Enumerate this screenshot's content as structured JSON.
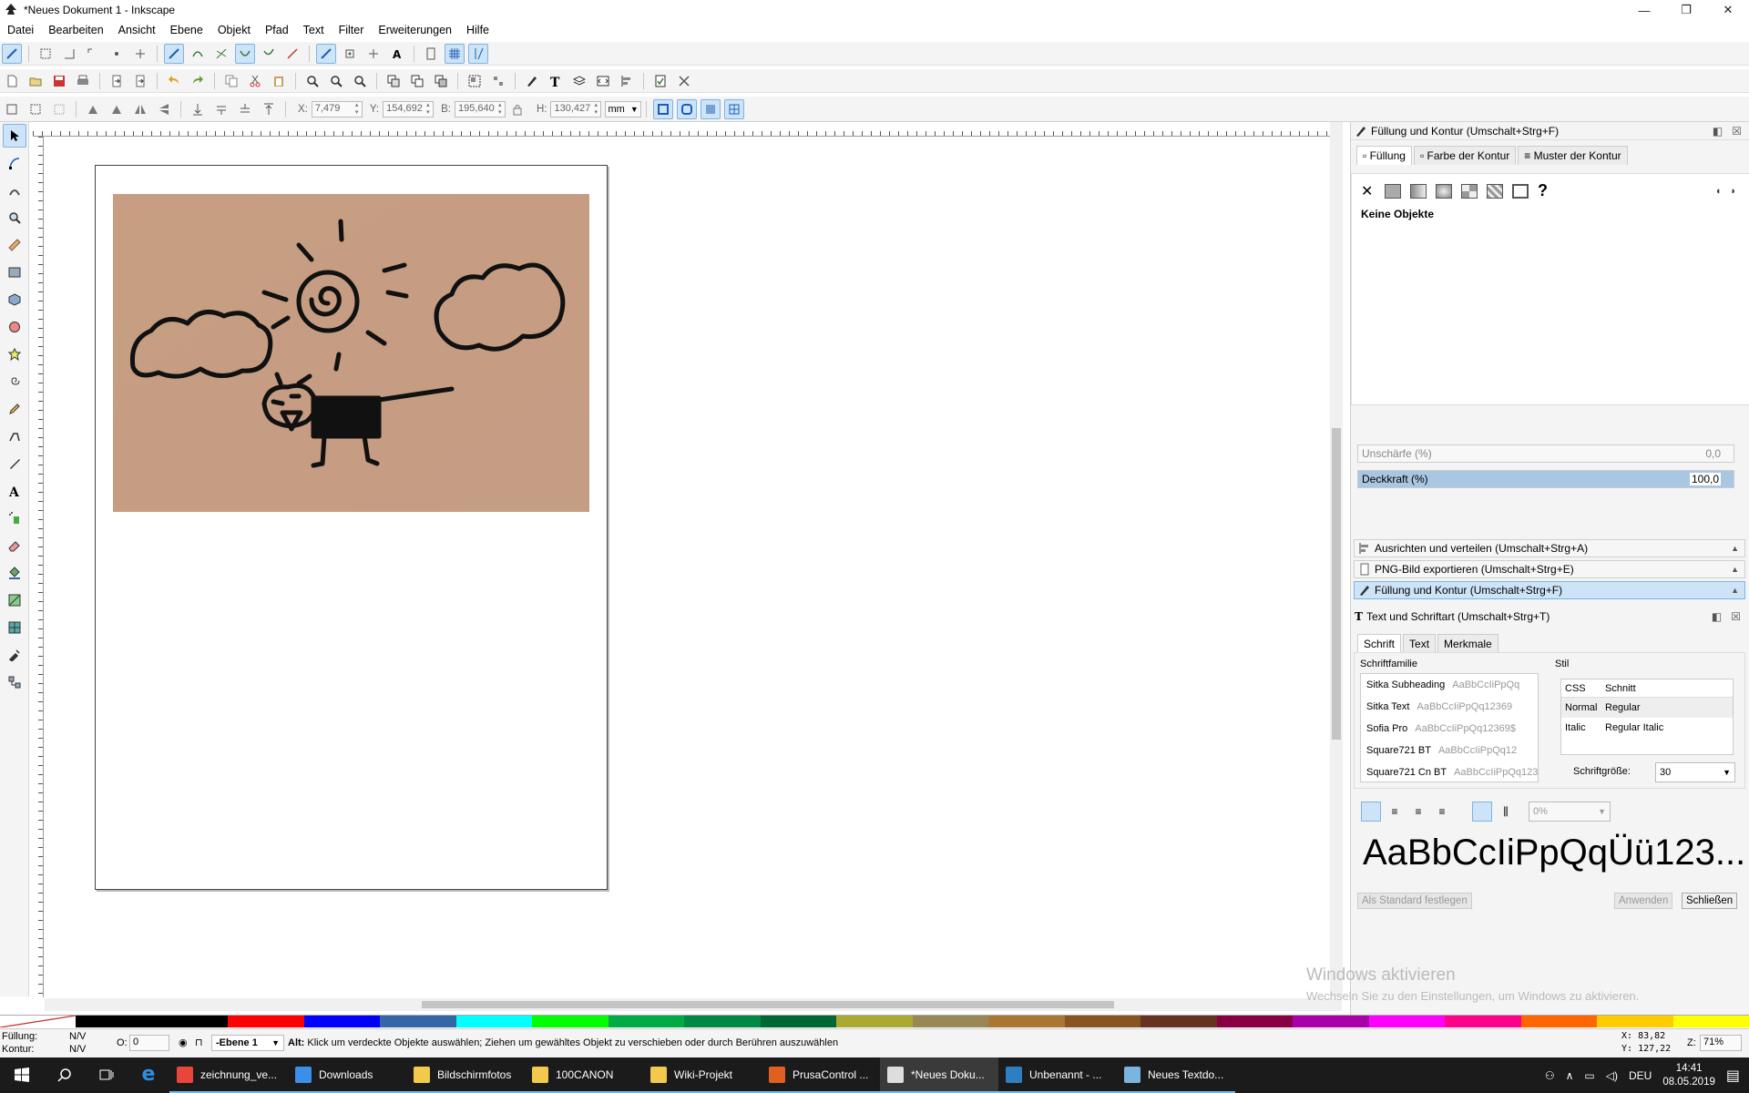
{
  "window": {
    "title": "*Neues Dokument 1 - Inkscape",
    "minimize_glyph": "—",
    "maximize_glyph": "❐",
    "close_glyph": "✕"
  },
  "menu": [
    "Datei",
    "Bearbeiten",
    "Ansicht",
    "Ebene",
    "Objekt",
    "Pfad",
    "Text",
    "Filter",
    "Erweiterungen",
    "Hilfe"
  ],
  "select_toolbar": {
    "x_label": "X:",
    "x_value": "7,479",
    "y_label": "Y:",
    "y_value": "154,692",
    "w_label": "B:",
    "w_value": "195,640",
    "h_label": "H:",
    "h_value": "130,427",
    "unit": "mm"
  },
  "fill_stroke": {
    "title": "Füllung und Kontur (Umschalt+Strg+F)",
    "tabs": [
      "Füllung",
      "Farbe der Kontur",
      "Muster der Kontur"
    ],
    "no_objects": "Keine Objekte",
    "blur_label": "Unschärfe (%)",
    "blur_value": "0,0",
    "opacity_label": "Deckkraft (%)",
    "opacity_value": "100,0",
    "unknown_glyph": "?"
  },
  "collapsed_panels": [
    "Ausrichten und verteilen (Umschalt+Strg+A)",
    "PNG-Bild exportieren (Umschalt+Strg+E)",
    "Füllung und Kontur (Umschalt+Strg+F)"
  ],
  "text_font": {
    "title": "Text und Schriftart (Umschalt+Strg+T)",
    "tabs": [
      "Schrift",
      "Text",
      "Merkmale"
    ],
    "family_label": "Schriftfamilie",
    "families": [
      {
        "name": "Sitka Subheading",
        "sample": "AaBbCcIiPpQq"
      },
      {
        "name": "Sitka Text",
        "sample": "AaBbCcIiPpQq12369"
      },
      {
        "name": "Sofia Pro",
        "sample": "AaBbCcIiPpQq12369$"
      },
      {
        "name": "Square721 BT",
        "sample": "AaBbCcIiPpQq12"
      },
      {
        "name": "Square721 Cn BT",
        "sample": "AaBbCcIiPpQq123"
      }
    ],
    "style_label": "Stil",
    "style_header": [
      "CSS",
      "Schnitt"
    ],
    "styles": [
      {
        "css": "Normal",
        "face": "Regular"
      },
      {
        "css": "Italic",
        "face": "Regular Italic"
      }
    ],
    "size_label": "Schriftgröße:",
    "size_value": "30",
    "spacing_value": "0%",
    "preview": "AaBbCcIiPpQqÜü123...",
    "set_default": "Als Standard festlegen",
    "apply": "Anwenden",
    "close": "Schließen"
  },
  "watermark": {
    "title": "Windows aktivieren",
    "text": "Wechseln Sie zu den Einstellungen, um Windows zu aktivieren."
  },
  "status": {
    "fill_label": "Füllung:",
    "fill_value": "N/V",
    "stroke_label": "Kontur:",
    "stroke_value": "N/V",
    "opacity_label": "O:",
    "opacity_value": "0",
    "layer": "-Ebene 1",
    "message_key": "Alt:",
    "message": " Klick um verdeckte Objekte auswählen; Ziehen um gewähltes Objekt zu verschieben oder durch Berühren auszuwählen",
    "x_label": "X:",
    "x_value": "83,82",
    "y_label": "Y:",
    "y_value": "127,22",
    "zoom_label": "Z:",
    "zoom_value": "71%"
  },
  "palette": [
    "#ffffff",
    "#000000",
    "#000000",
    "#ff0000",
    "#0000ff",
    "#3465a4",
    "#00ffff",
    "#00ff00",
    "#00aa44",
    "#008844",
    "#006633",
    "#aaaa33",
    "#998855",
    "#aa7733",
    "#885522",
    "#663322",
    "#880044",
    "#aa00aa",
    "#ff00ff",
    "#ff0088",
    "#ff6600",
    "#ffcc00",
    "#ffff00"
  ],
  "taskbar": {
    "items": [
      {
        "label": "zeichnung_ve...",
        "icon": "chrome-icon",
        "color": "#e8453c",
        "state": "run"
      },
      {
        "label": "Downloads",
        "icon": "download-folder-icon",
        "color": "#3c8fe8",
        "state": "run"
      },
      {
        "label": "Bildschirmfotos",
        "icon": "folder-icon",
        "color": "#f2c94c",
        "state": "run"
      },
      {
        "label": "100CANON",
        "icon": "folder-icon",
        "color": "#f2c94c",
        "state": "run"
      },
      {
        "label": "Wiki-Projekt",
        "icon": "folder-icon",
        "color": "#f2c94c",
        "state": "run"
      },
      {
        "label": "PrusaControl ...",
        "icon": "prusacontrol-icon",
        "color": "#e0601f",
        "state": "run"
      },
      {
        "label": "*Neues Doku...",
        "icon": "inkscape-icon",
        "color": "#dddddd",
        "state": "active"
      },
      {
        "label": "Unbenannt - ...",
        "icon": "editor-icon",
        "color": "#2d7fc1",
        "state": "run"
      },
      {
        "label": "Neues Textdo...",
        "icon": "notepad-icon",
        "color": "#7ab4e0",
        "state": "run"
      }
    ],
    "language": "DEU",
    "time": "14:41",
    "date": "08.05.2019"
  }
}
